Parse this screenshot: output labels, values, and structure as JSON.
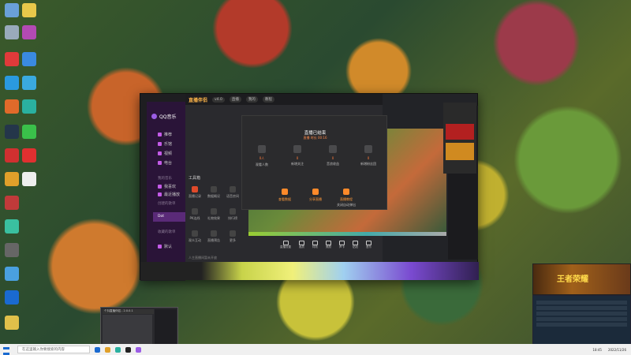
{
  "qq": {
    "title": "QQ音乐",
    "nav": [
      "推荐",
      "乐馆",
      "视频",
      "电台",
      "我喜欢",
      "最近播放",
      "本地和下载",
      "已购音乐"
    ],
    "section_mine": "我的音乐",
    "section_created": "创建的歌单",
    "section_collected": "收藏的歌单",
    "selected": "Dot",
    "item_bottom": "默认"
  },
  "app": {
    "brand": "直播伴侣",
    "version": "v4.0",
    "tabs": [
      "直播",
      "我的",
      "教程"
    ],
    "tools_label": "工具箱",
    "grid_items": [
      "直播记录",
      "数据概况",
      "语音房间",
      "PK连线",
      "礼物效果",
      "排行榜",
      "观众互动",
      "直播预告",
      "更多"
    ],
    "notice": "人主直播间暂未开放"
  },
  "modal": {
    "title": "直播已结束",
    "subtitle": "直播 时长 00:16",
    "stats": [
      {
        "label": "观看人数",
        "value": "0人"
      },
      {
        "label": "新增关注",
        "value": "0"
      },
      {
        "label": "音浪收益",
        "value": "0"
      },
      {
        "label": "新增粉丝团",
        "value": "0"
      }
    ],
    "actions": [
      "查看数据",
      "分享直播",
      "直播教程"
    ],
    "footer": "关闭自动弹出"
  },
  "controls": [
    "直播设置",
    "画质",
    "特效",
    "美颜",
    "声卡",
    "贴纸",
    "音乐"
  ],
  "popup": {
    "title": "个抖直播伴侣 - 2.0.0.1"
  },
  "game_ad": {
    "title": "王者荣耀"
  },
  "taskbar": {
    "search_placeholder": "在这里输入你要搜索的内容",
    "time": "18:45",
    "date": "2022/11/26"
  }
}
